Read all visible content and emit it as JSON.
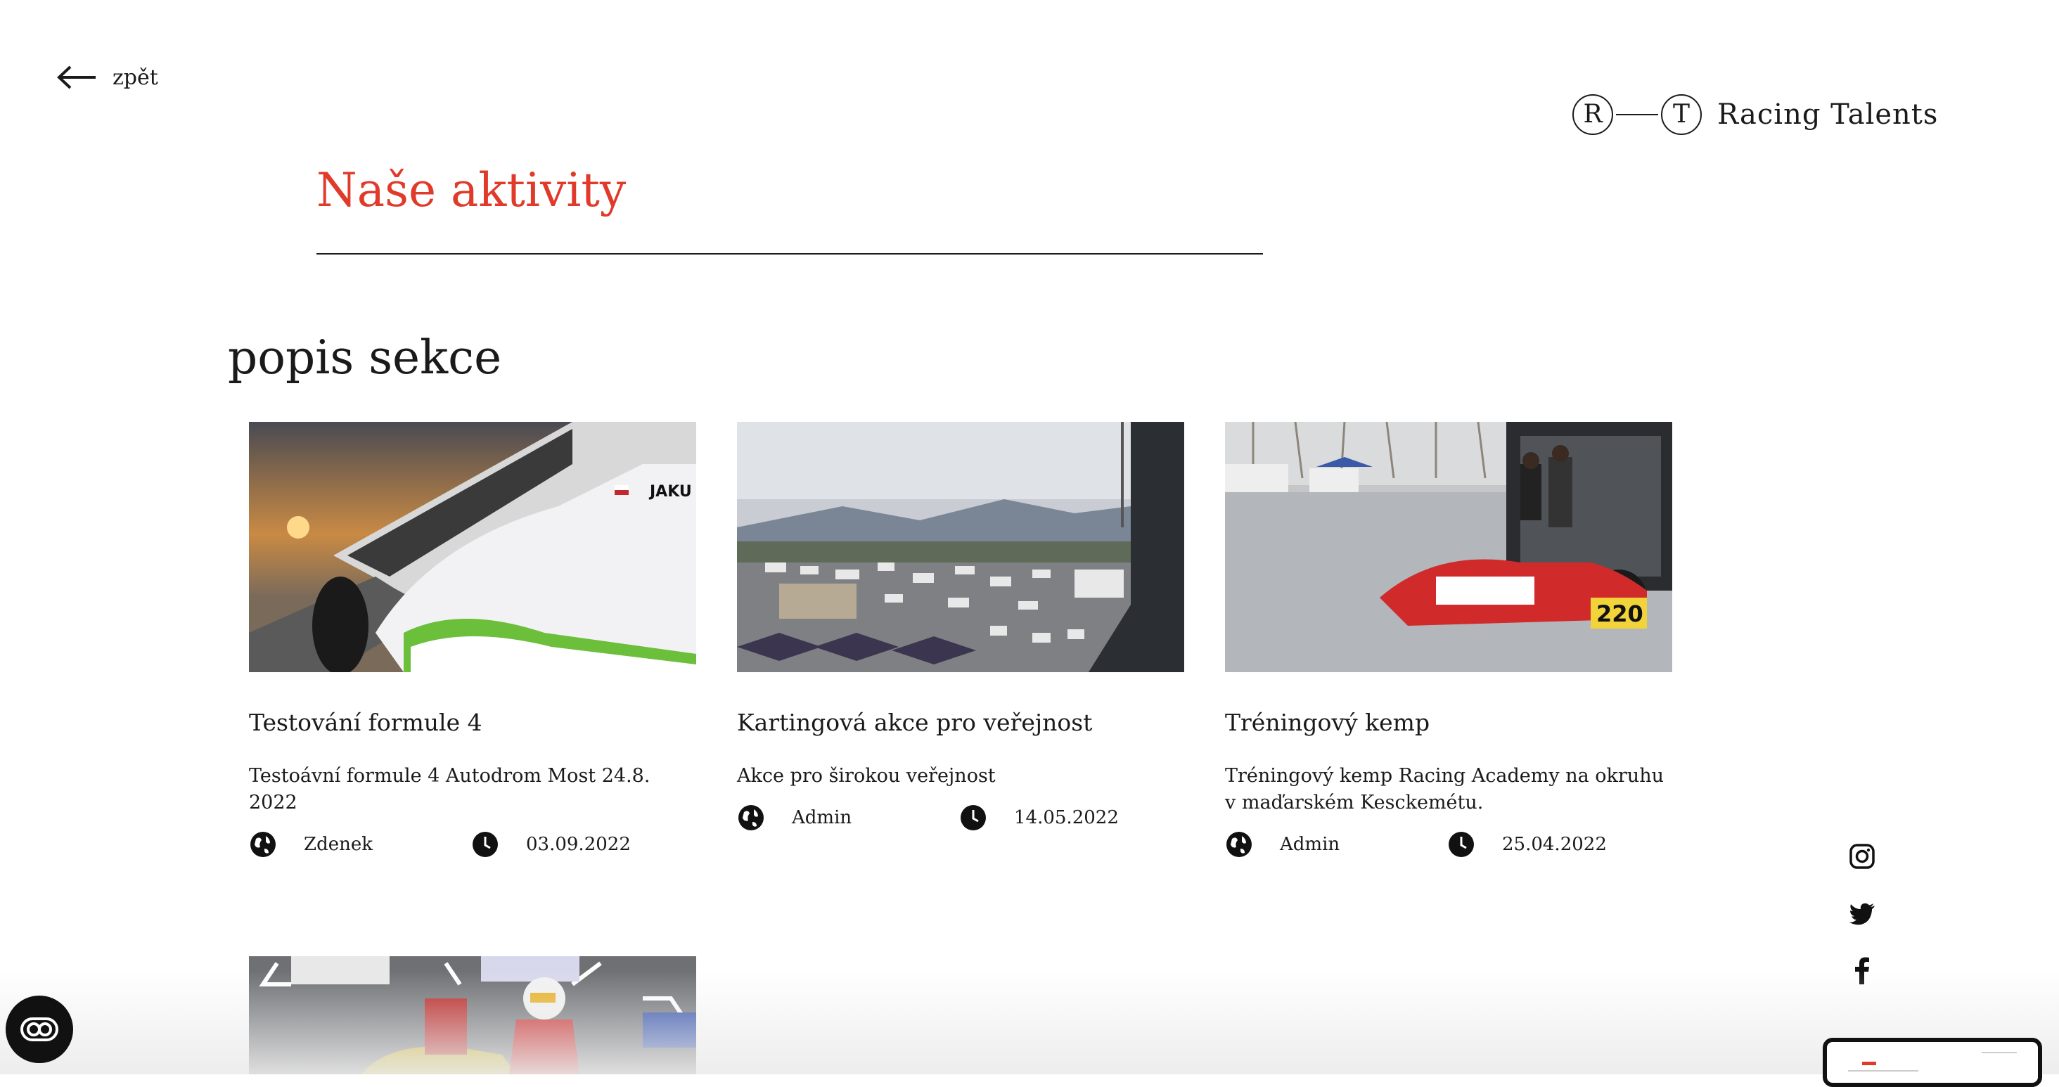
{
  "nav": {
    "back_label": "zpět"
  },
  "logo": {
    "letter_left": "R",
    "letter_right": "T",
    "text": "Racing Talents"
  },
  "header": {
    "title": "Naše aktivity",
    "title_color": "#e03a2a"
  },
  "section": {
    "title": "popis sekce"
  },
  "cards": [
    {
      "title": "Testování formule 4",
      "description": "Testoávní formule 4 Autodrom Most 24.8. 2022",
      "author": "Zdenek",
      "date": "03.09.2022"
    },
    {
      "title": "Kartingová akce pro veřejnost",
      "description": "Akce pro širokou veřejnost",
      "author": "Admin",
      "date": "14.05.2022"
    },
    {
      "title": "Tréningový kemp",
      "description": "Tréningový kemp Racing Academy na okruhu v maďarském Kesckemétu.",
      "author": "Admin",
      "date": "25.04.2022"
    }
  ],
  "card4": {
    "image": "karting-race-photo"
  },
  "social": [
    "instagram-icon",
    "twitter-icon",
    "facebook-icon"
  ],
  "icons": {
    "author": "globe-icon",
    "date": "clock-icon"
  },
  "widget": {
    "accessibility": "accessibility-toggle-icon"
  }
}
